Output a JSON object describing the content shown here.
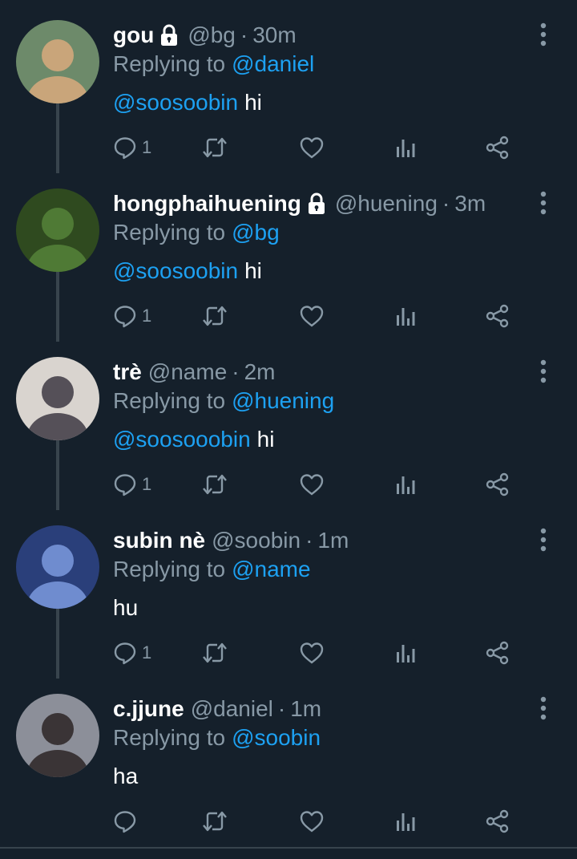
{
  "tweets": [
    {
      "display_name": "gou",
      "locked": true,
      "handle": "@bg",
      "time": "30m",
      "replying_label": "Replying to",
      "replying_to": "@daniel",
      "mention": "@soosoobin",
      "text": "hi",
      "reply_count": "1",
      "avatar": {
        "bg": "#6d8a6a",
        "fg": "#c9a57a"
      }
    },
    {
      "display_name": "hongphaihuening",
      "locked": true,
      "handle": "@huening",
      "time": "3m",
      "replying_label": "Replying to",
      "replying_to": "@bg",
      "mention": "@soosoobin",
      "text": "hi",
      "reply_count": "1",
      "avatar": {
        "bg": "#2f4a1f",
        "fg": "#4f7a35"
      }
    },
    {
      "display_name": "trè",
      "locked": false,
      "handle": "@name",
      "time": "2m",
      "replying_label": "Replying to",
      "replying_to": "@huening",
      "mention": "@soosooobin",
      "text": "hi",
      "reply_count": "1",
      "avatar": {
        "bg": "#d9d4cf",
        "fg": "#555058"
      }
    },
    {
      "display_name": "subin nè",
      "locked": false,
      "handle": "@soobin",
      "time": "1m",
      "replying_label": "Replying to",
      "replying_to": "@name",
      "mention": "",
      "text": "hu",
      "reply_count": "1",
      "avatar": {
        "bg": "#2a3f7a",
        "fg": "#6f8ccf"
      }
    },
    {
      "display_name": "c.jjune",
      "locked": false,
      "handle": "@daniel",
      "time": "1m",
      "replying_label": "Replying to",
      "replying_to": "@soobin",
      "mention": "",
      "text": "ha",
      "reply_count": "",
      "avatar": {
        "bg": "#8c8f99",
        "fg": "#3a3436"
      }
    }
  ],
  "separator": "·",
  "icons": {
    "lock": "lock-icon",
    "more": "more-vertical-icon",
    "reply": "reply-icon",
    "retweet": "retweet-icon",
    "like": "heart-icon",
    "analytics": "analytics-icon",
    "share": "share-icon"
  },
  "colors": {
    "background": "#15202b",
    "primary_text": "#ffffff",
    "secondary_text": "#8899a6",
    "accent": "#1da1f2",
    "divider": "#38444d"
  }
}
